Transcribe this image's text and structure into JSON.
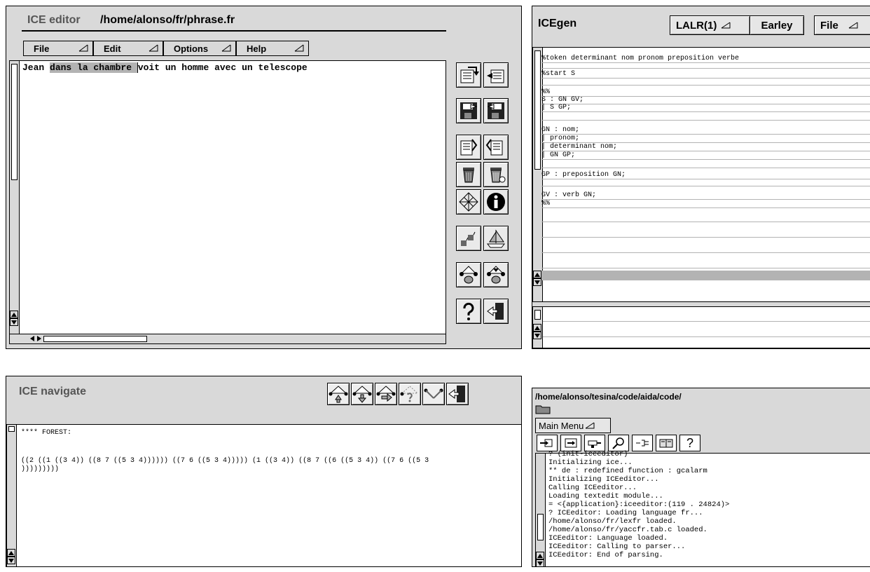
{
  "editor": {
    "app_name": "ICE editor",
    "file_path": "/home/alonso/fr/phrase.fr",
    "menus": [
      "File",
      "Edit",
      "Options",
      "Help"
    ],
    "sentence": {
      "before": "Jean ",
      "highlight": "dans la chambre ",
      "cursor_char": "v",
      "after": "oit un homme avec un telescope"
    },
    "tool_icons": [
      "edit-forward-icon",
      "edit-back-icon",
      "save-icon",
      "save-as-icon",
      "compile-icon",
      "compile-all-icon",
      "trash-icon",
      "trash-all-icon",
      "grid-icon",
      "info-icon",
      "stairs-icon",
      "boat-icon",
      "tree-up-icon",
      "tree-down-icon",
      "help-icon",
      "exit-icon"
    ]
  },
  "gen": {
    "app_name": "ICEgen",
    "parser_menu": "LALR(1)",
    "earley_button": "Earley",
    "file_menu": "File",
    "grammar_lines": [
      "%token determinant nom pronom preposition verbe",
      "%start S",
      "%%",
      "S : GN GV;",
      "   | S GP;",
      "GN : nom;",
      "   | pronom;",
      "   | determinant nom;",
      "   | GN GP;",
      "GP : preposition GN;",
      "GV : verb GN;",
      "%%"
    ]
  },
  "navigate": {
    "app_name": "ICE navigate",
    "forest_label": "**** FOREST:",
    "forest_line1": "((2 ((1 ((3 4)) ((8 7 ((5 3 4)))))) ((7 6 ((5 3 4))))) (1 ((3 4)) ((8 7 ((6 ((5 3 4)) ((7 6 ((5 3",
    "forest_line2": ")))))))))",
    "nav_icons": [
      "tree-up-icon",
      "tree-down-icon",
      "tree-right-icon",
      "tree-help-icon",
      "tree-branch-icon",
      "exit-icon"
    ]
  },
  "console": {
    "path": "/home/alonso/tesina/code/aida/code/",
    "main_menu": "Main Menu",
    "tool_icons": [
      "load-icon",
      "enter-icon",
      "drill-icon",
      "search-icon",
      "unplug-icon",
      "book-icon",
      "help-icon"
    ],
    "help_glyph": "?",
    "lines": [
      "? (init-iceeditor)",
      "Initializing ice...",
      "** de : redefined function : gcalarm",
      "Initializing ICEeditor...",
      "Calling ICEeditor...",
      "Loading textedit module...",
      "= <{application}:iceeditor:(119 . 24824)>",
      "? ICEeditor: Loading language fr...",
      "/home/alonso/fr/lexfr loaded.",
      "/home/alonso/fr/yaccfr.tab.c loaded.",
      "ICEeditor: Language loaded.",
      "ICEeditor: Calling to parser...",
      "ICEeditor: End of parsing."
    ]
  }
}
